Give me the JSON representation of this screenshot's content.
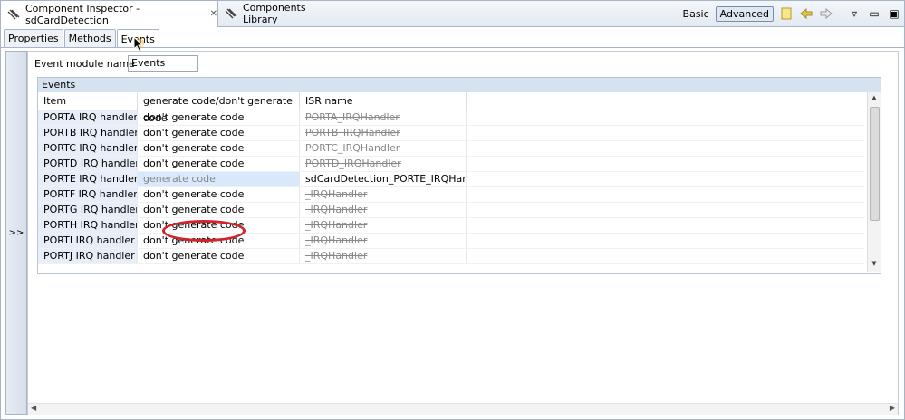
{
  "viewbar": {
    "active_tab": "Component Inspector - sdCardDetection",
    "inactive_tab": "Components Library",
    "mode_basic": "Basic",
    "mode_advanced": "Advanced"
  },
  "subtabs": [
    "Properties",
    "Methods",
    "Events"
  ],
  "collapse_label": ">>",
  "event_module": {
    "label": "Event module name",
    "value": "Events"
  },
  "group_title": "Events",
  "table": {
    "headers": [
      "Item",
      "generate code/don't generate code",
      "ISR name"
    ],
    "rows": [
      {
        "item": "PORTA IRQ handler",
        "gen": "don't generate code",
        "isr": "PORTA_IRQHandler"
      },
      {
        "item": "PORTB IRQ handler",
        "gen": "don't generate code",
        "isr": "PORTB_IRQHandler"
      },
      {
        "item": "PORTC IRQ handler",
        "gen": "don't generate code",
        "isr": "PORTC_IRQHandler"
      },
      {
        "item": "PORTD IRQ handler",
        "gen": "don't generate code",
        "isr": "PORTD_IRQHandler"
      },
      {
        "item": "PORTE IRQ handler",
        "gen": "generate code",
        "isr": "sdCardDetection_PORTE_IRQHandler"
      },
      {
        "item": "PORTF IRQ handler",
        "gen": "don't generate code",
        "isr": "_IRQHandler"
      },
      {
        "item": "PORTG IRQ handler",
        "gen": "don't generate code",
        "isr": "_IRQHandler"
      },
      {
        "item": "PORTH IRQ handler",
        "gen": "don't generate code",
        "isr": "_IRQHandler"
      },
      {
        "item": "PORTI IRQ handler",
        "gen": "don't generate code",
        "isr": "_IRQHandler"
      },
      {
        "item": "PORTJ IRQ handler",
        "gen": "don't generate code",
        "isr": "_IRQHandler"
      }
    ]
  },
  "colors": {
    "highlight": "#d2232a",
    "selection": "#d9e8fb",
    "item_bg": "#e7eef7"
  }
}
